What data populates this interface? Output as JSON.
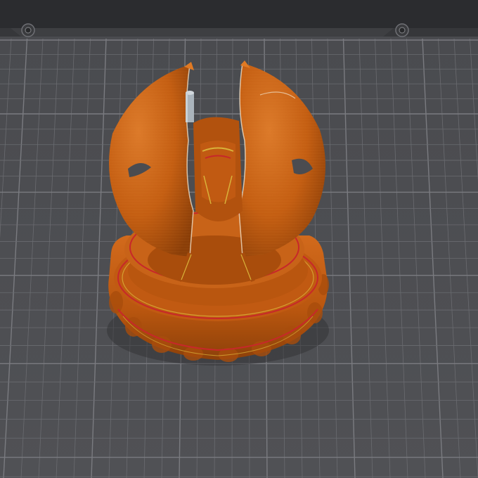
{
  "viewer": {
    "type": "3d-print-slicer-preview",
    "background_color": "#3e3f42",
    "frame_color": "#2b2c2f",
    "build_plate_color": "#4b4c50",
    "grid_line_color": "#6a6b70",
    "grid_major_color": "#7a7b80",
    "bed_grid": "visible",
    "clip_icons": [
      "plate-clip-icon",
      "plate-clip-icon"
    ]
  },
  "model": {
    "name": "",
    "filament_color": "#c45e12",
    "filament_highlight": "#e07a24",
    "filament_shadow": "#8a3e08",
    "inner_wall_color": "#d8b23a",
    "outer_wall_accent": "#c7282a",
    "support_pin_color": "#aab4bc",
    "parts": [
      "base-ring",
      "dome-petals",
      "core-stem",
      "support-pin"
    ]
  }
}
